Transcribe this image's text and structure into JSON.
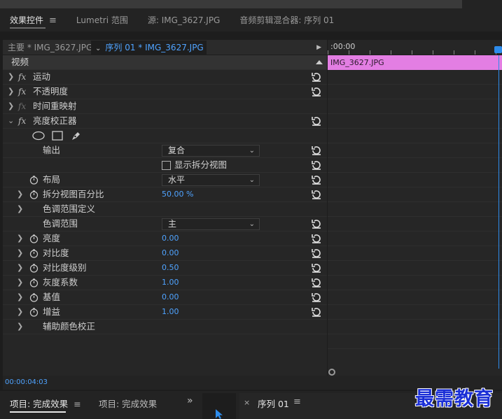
{
  "tabs": [
    {
      "label": "效果控件",
      "active": true
    },
    {
      "label": "Lumetri 范围"
    },
    {
      "label": "源: IMG_3627.JPG"
    },
    {
      "label": "音频剪辑混合器: 序列 01"
    }
  ],
  "source_bar": {
    "main_label": "主要 * IMG_3627.JPG",
    "sequence_label": "序列 01 * IMG_3627.JPG"
  },
  "section_header": "视频",
  "effects": {
    "motion": "运动",
    "opacity": "不透明度",
    "time_remap": "时间重映射",
    "brightness_corrector": "亮度校正器"
  },
  "properties": {
    "output": {
      "label": "输出",
      "value": "复合"
    },
    "split_view_checkbox": {
      "label": "显示拆分视图",
      "checked": false
    },
    "layout": {
      "label": "布局",
      "value": "水平"
    },
    "split_view_percent": {
      "label": "拆分视图百分比",
      "value": "50.00 %"
    },
    "tonal_range_definition": {
      "label": "色调范围定义"
    },
    "tonal_range": {
      "label": "色调范围",
      "value": "主"
    },
    "brightness": {
      "label": "亮度",
      "value": "0.00"
    },
    "contrast": {
      "label": "对比度",
      "value": "0.00"
    },
    "contrast_level": {
      "label": "对比度级别",
      "value": "0.50"
    },
    "gamma": {
      "label": "灰度系数",
      "value": "1.00"
    },
    "pedestal": {
      "label": "基值",
      "value": "0.00"
    },
    "gain": {
      "label": "增益",
      "value": "1.00"
    },
    "secondary_color_correction": {
      "label": "辅助颜色校正"
    }
  },
  "timeline": {
    "timecode": ":00:00",
    "clip_label": "IMG_3627.JPG",
    "clip_color": "#e37ee3"
  },
  "status": {
    "timecode": "00:00:04:03"
  },
  "bottom": {
    "tab_project_active": "项目: 完成效果",
    "tab_project_2": "项目: 完成效果",
    "overflow": "»",
    "sequence_tab": "序列 01",
    "close": "×"
  },
  "watermark": "最需教育",
  "colors": {
    "accent_blue": "#4fa3ff",
    "playhead": "#2d8ceb",
    "watermark": "#1b2fd6"
  }
}
